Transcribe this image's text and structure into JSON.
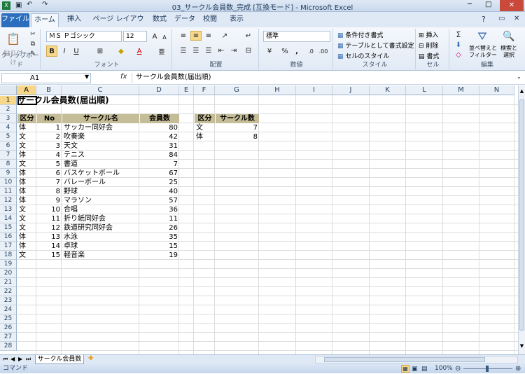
{
  "window": {
    "title": "03_サークル会員数_完成 [互換モード] - Microsoft Excel"
  },
  "tabs": [
    "ファイル",
    "ホーム",
    "挿入",
    "ページ レイアウト",
    "数式",
    "データ",
    "校閲",
    "表示"
  ],
  "ribbon": {
    "clipboard": {
      "label": "クリップボード",
      "paste": "貼り付け"
    },
    "font": {
      "label": "フォント",
      "name": "ＭＳ Ｐゴシック",
      "size": "12",
      "bold": "B",
      "italic": "I",
      "underline": "U"
    },
    "alignment": {
      "label": "配置"
    },
    "number": {
      "label": "数値",
      "format": "標準",
      "percent": "%",
      "comma": ","
    },
    "styles": {
      "label": "スタイル",
      "conditional": "条件付き書式",
      "table": "テーブルとして書式設定",
      "cell": "セルのスタイル"
    },
    "cells": {
      "label": "セル",
      "insert": "挿入",
      "delete": "削除",
      "format": "書式"
    },
    "editing": {
      "label": "編集",
      "sort": "並べ替えと\nフィルター",
      "find": "検索と\n選択"
    }
  },
  "formula_bar": {
    "name_box": "A1",
    "fx": "fx",
    "content": "サークル会員数(届出順)"
  },
  "columns": [
    "A",
    "B",
    "C",
    "D",
    "E",
    "F",
    "G",
    "H",
    "I",
    "J",
    "K",
    "L",
    "M",
    "N"
  ],
  "rows": [
    "1",
    "2",
    "3",
    "4",
    "5",
    "6",
    "7",
    "8",
    "9",
    "10",
    "11",
    "12",
    "13",
    "14",
    "15",
    "16",
    "17",
    "18",
    "19",
    "20",
    "21",
    "22",
    "23",
    "24",
    "25",
    "26",
    "27",
    "28"
  ],
  "sheet": {
    "title": "サークル会員数(届出順)",
    "headers": [
      "区分",
      "No",
      "サークル名",
      "会員数"
    ],
    "data": [
      [
        "体",
        "1",
        "サッカー同好会",
        "80"
      ],
      [
        "文",
        "2",
        "吹奏楽",
        "42"
      ],
      [
        "文",
        "3",
        "天文",
        "31"
      ],
      [
        "体",
        "4",
        "テニス",
        "84"
      ],
      [
        "文",
        "5",
        "書道",
        "7"
      ],
      [
        "体",
        "6",
        "バスケットボール",
        "67"
      ],
      [
        "体",
        "7",
        "バレーボール",
        "25"
      ],
      [
        "体",
        "8",
        "野球",
        "40"
      ],
      [
        "体",
        "9",
        "マラソン",
        "57"
      ],
      [
        "文",
        "10",
        "合唱",
        "36"
      ],
      [
        "文",
        "11",
        "折り紙同好会",
        "11"
      ],
      [
        "文",
        "12",
        "鉄道研究同好会",
        "26"
      ],
      [
        "体",
        "13",
        "水泳",
        "35"
      ],
      [
        "体",
        "14",
        "卓球",
        "15"
      ],
      [
        "文",
        "15",
        "軽音楽",
        "19"
      ]
    ],
    "summary_headers": [
      "区分",
      "サークル数"
    ],
    "summary": [
      [
        "文",
        "7"
      ],
      [
        "体",
        "8"
      ]
    ]
  },
  "sheet_tab": "サークル会員数",
  "status": {
    "mode": "コマンド",
    "zoom": "100%"
  }
}
